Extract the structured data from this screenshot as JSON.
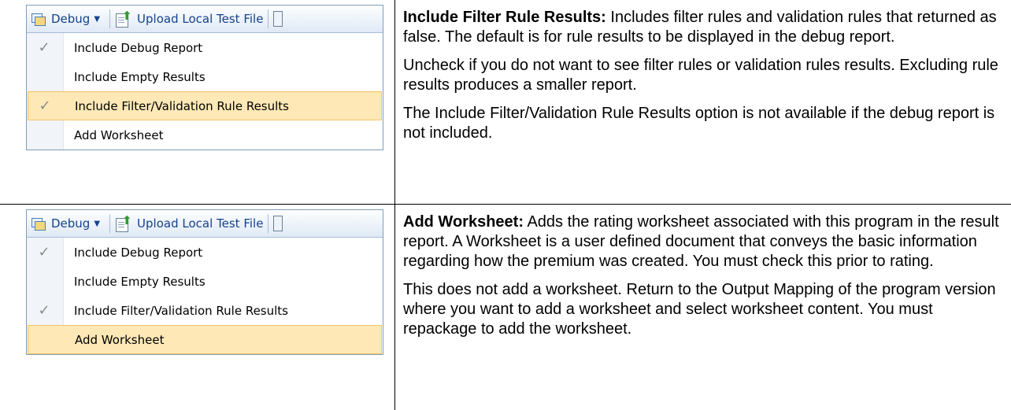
{
  "rows": [
    {
      "menu": {
        "toolbar": {
          "debug_label": "Debug",
          "upload_label": "Upload Local Test File"
        },
        "items": [
          {
            "label": "Include Debug Report",
            "checked": true,
            "highlighted": false
          },
          {
            "label": "Include Empty Results",
            "checked": false,
            "highlighted": false
          },
          {
            "label": "Include Filter/Validation Rule Results",
            "checked": true,
            "highlighted": true
          },
          {
            "label": "Add Worksheet",
            "checked": false,
            "highlighted": false
          }
        ]
      },
      "title": "Include Filter Rule Results:",
      "lead": "Includes filter rules and validation rules that returned as false.  The default is for rule results to be displayed in the debug report.",
      "paragraphs": [
        "Uncheck if you do not want to see filter rules or validation rules results. Excluding rule results produces a smaller report.",
        "The Include Filter/Validation Rule Results option is not available if the debug report is not included."
      ]
    },
    {
      "menu": {
        "toolbar": {
          "debug_label": "Debug",
          "upload_label": "Upload Local Test File"
        },
        "items": [
          {
            "label": "Include Debug Report",
            "checked": true,
            "highlighted": false
          },
          {
            "label": "Include Empty Results",
            "checked": false,
            "highlighted": false
          },
          {
            "label": "Include Filter/Validation Rule Results",
            "checked": true,
            "highlighted": false
          },
          {
            "label": "Add Worksheet",
            "checked": false,
            "highlighted": true
          }
        ]
      },
      "title": "Add Worksheet:",
      "lead": "Adds the rating worksheet associated with this program in the result report. A Worksheet is a user defined document that conveys the basic information regarding how the premium was created. You must check this prior to rating.",
      "paragraphs": [
        "This does not add a worksheet. Return to the Output Mapping of the program version where you want to add a worksheet and select worksheet content.  You must repackage to add the worksheet."
      ]
    }
  ],
  "check_glyph": "✓",
  "colors": {
    "highlight": "#fde8b6",
    "highlight_border": "#f5c46a",
    "toolbar_text": "#15428b"
  }
}
